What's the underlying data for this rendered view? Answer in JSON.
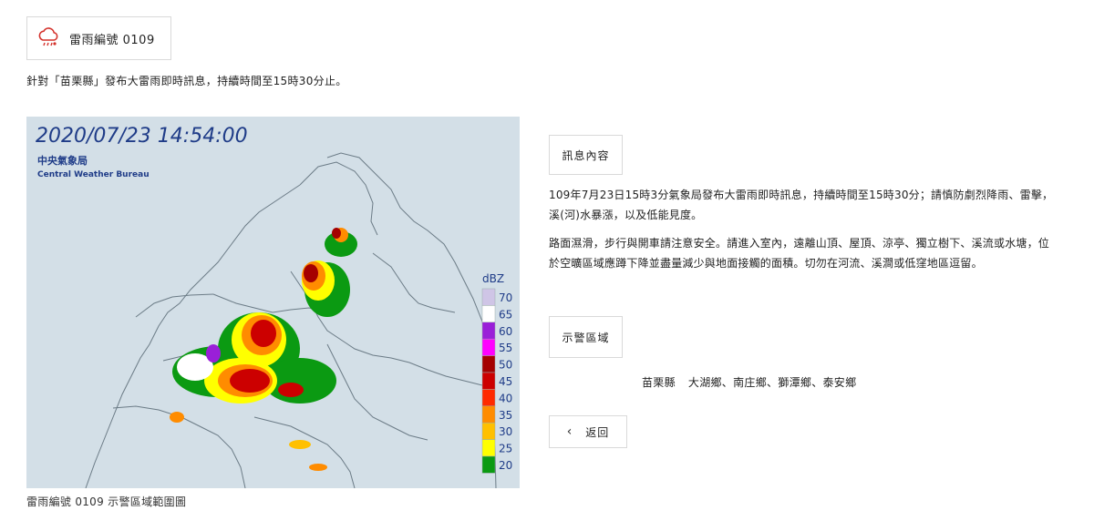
{
  "header": {
    "icon": "rain-cloud-icon",
    "title": "雷雨編號 0109"
  },
  "summary": "針對「苗栗縣」發布大雷雨即時訊息，持續時間至15時30分止。",
  "map": {
    "timestamp": "2020/07/23 14:54:00",
    "agency_zh": "中央氣象局",
    "agency_en": "Central Weather Bureau",
    "legend_unit": "dBZ",
    "legend": [
      {
        "label": "70",
        "color": "#cfc5e6"
      },
      {
        "label": "65",
        "color": "#ffffff"
      },
      {
        "label": "60",
        "color": "#9a1fd8"
      },
      {
        "label": "55",
        "color": "#ff00ff"
      },
      {
        "label": "50",
        "color": "#a50000"
      },
      {
        "label": "45",
        "color": "#cc0000"
      },
      {
        "label": "40",
        "color": "#ff2a00"
      },
      {
        "label": "35",
        "color": "#ff8c00"
      },
      {
        "label": "30",
        "color": "#ffc000"
      },
      {
        "label": "25",
        "color": "#ffff00"
      },
      {
        "label": "20",
        "color": "#0b9a12"
      }
    ],
    "background": "#d3dfe7",
    "caption": "雷雨編號 0109 示警區域範圍圖"
  },
  "message": {
    "header": "訊息內容",
    "paragraph1": "109年7月23日15時3分氣象局發布大雷雨即時訊息，持續時間至15時30分；請慎防劇烈降雨、雷擊，溪(河)水暴漲，以及低能見度。",
    "paragraph2": "路面濕滑，步行與開車請注意安全。請進入室內，遠離山頂、屋頂、涼亭、獨立樹下、溪流或水塘，位於空曠區域應蹲下降並盡量減少與地面接觸的面積。切勿在河流、溪澗或低窪地區逗留。"
  },
  "warning_area": {
    "header": "示警區域",
    "county": "苗栗縣",
    "townships": "大湖鄉、南庄鄉、獅潭鄉、泰安鄉"
  },
  "back_button": {
    "icon": "chevron-left-icon",
    "label": "返回"
  }
}
